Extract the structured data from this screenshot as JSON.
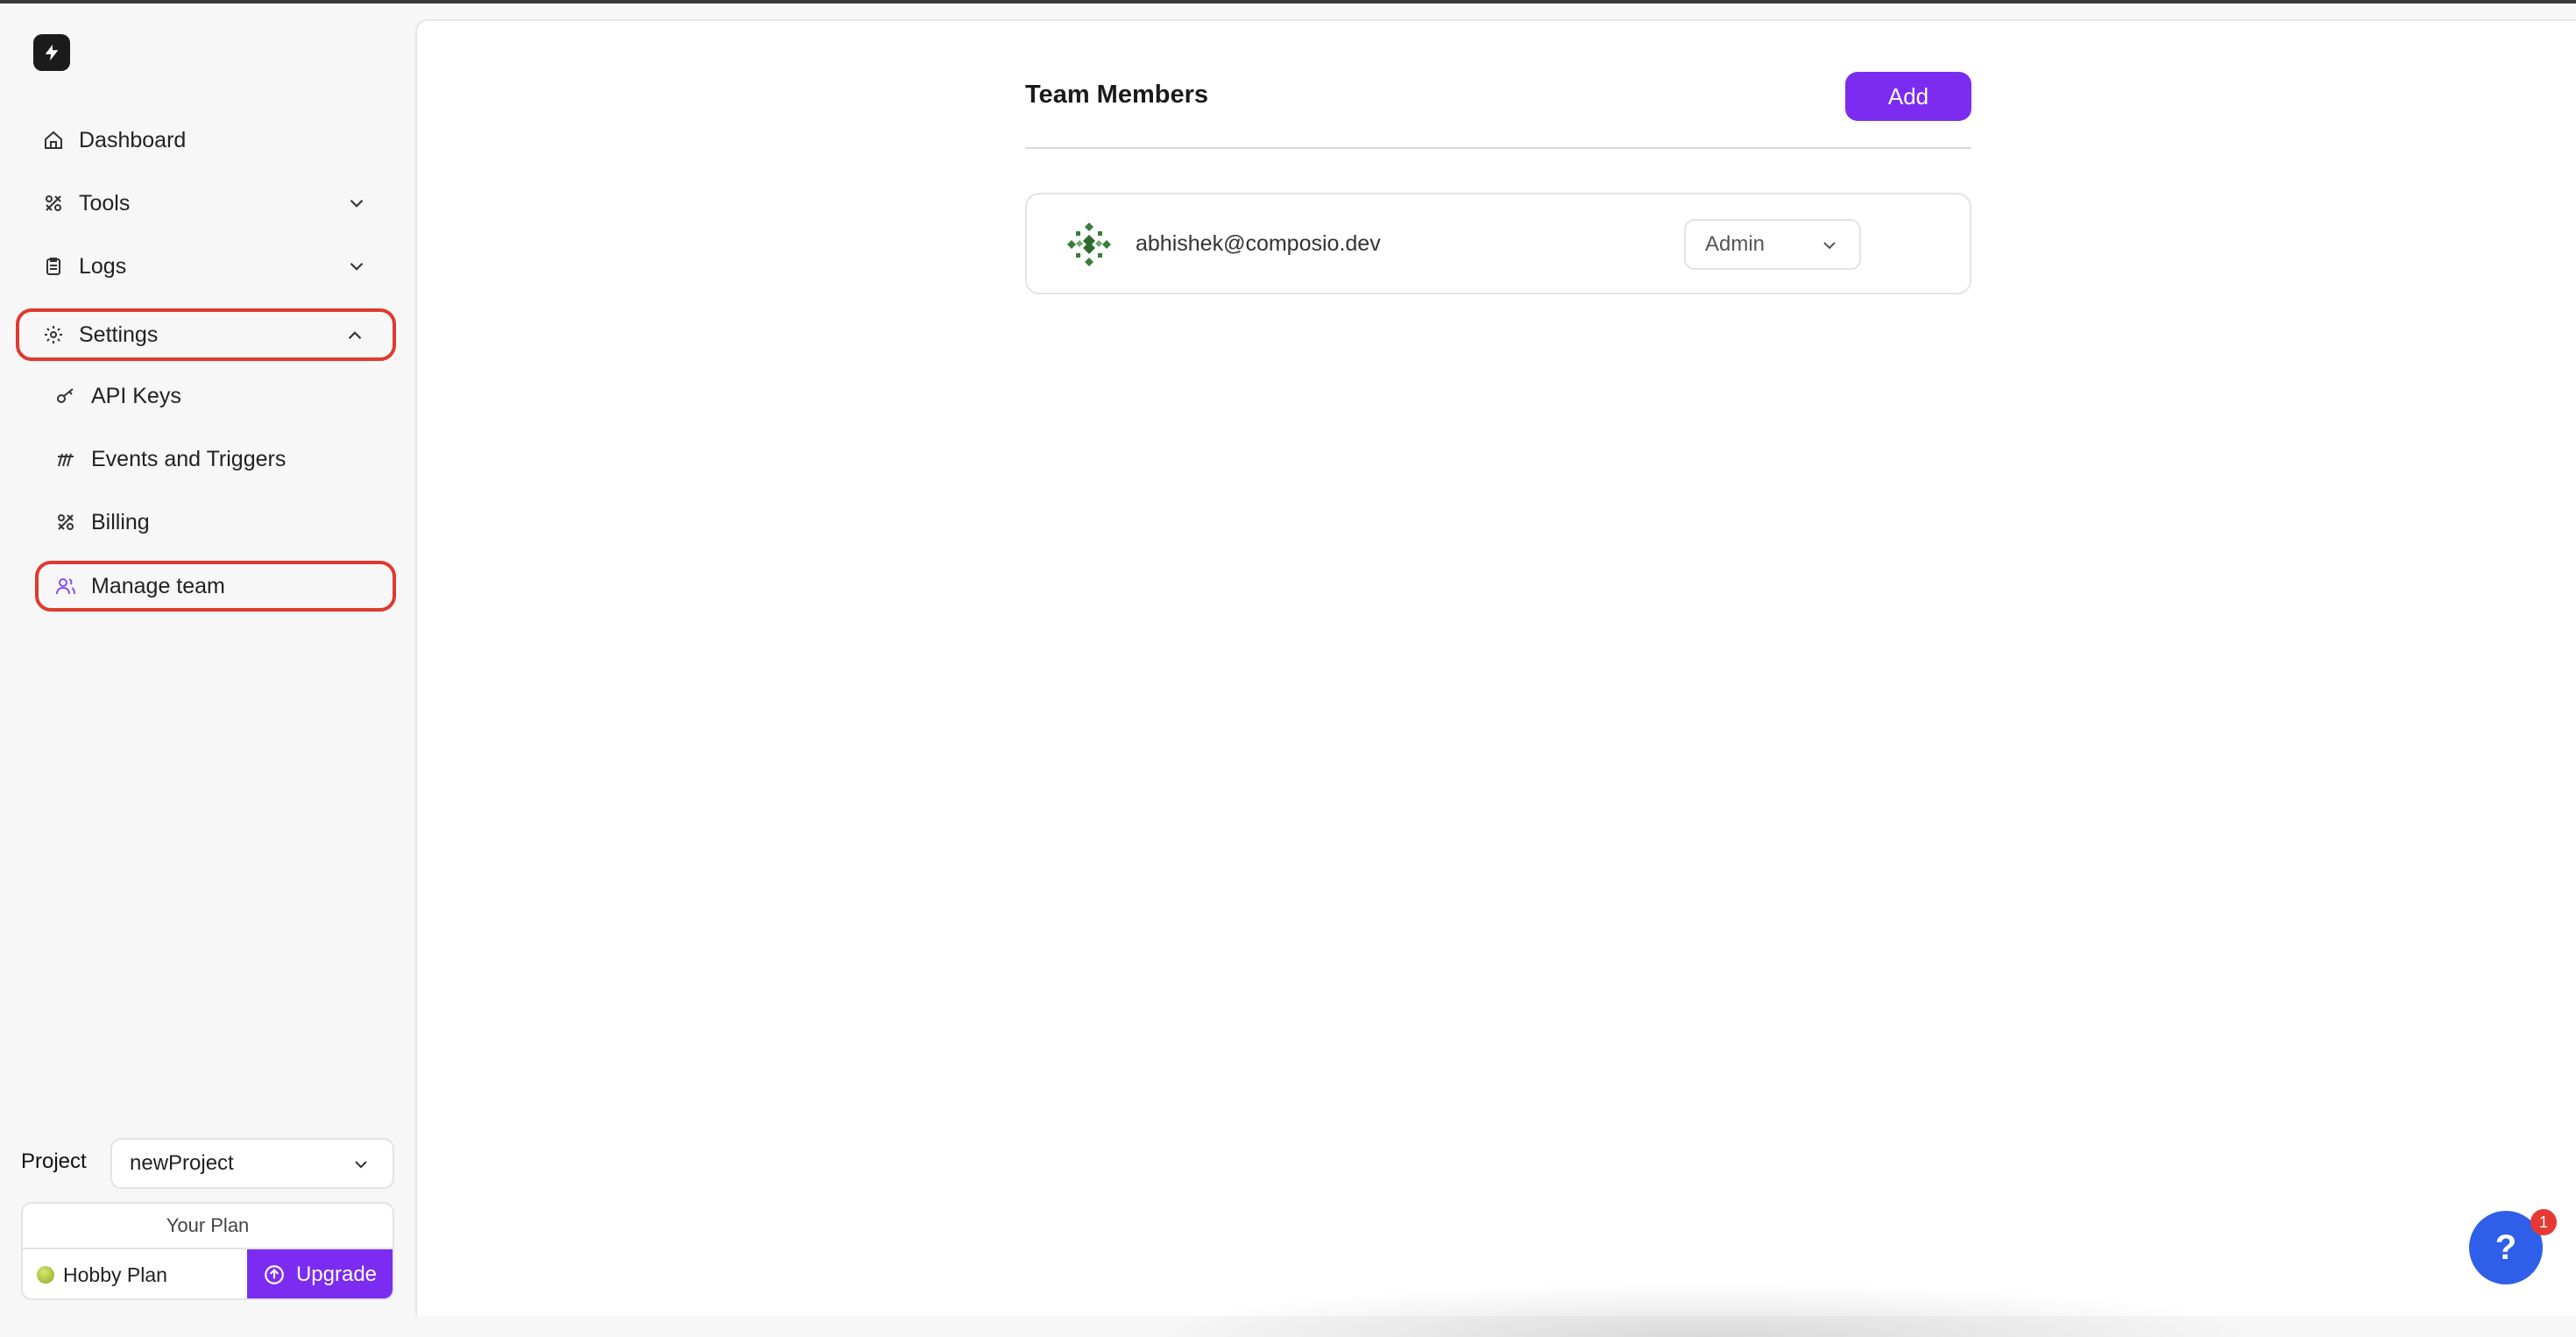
{
  "sidebar": {
    "items": [
      {
        "label": "Dashboard",
        "icon": "home-icon"
      },
      {
        "label": "Tools",
        "icon": "tools-icon"
      },
      {
        "label": "Logs",
        "icon": "clipboard-icon"
      },
      {
        "label": "Settings",
        "icon": "gear-icon"
      }
    ],
    "settings_sub": [
      {
        "label": "API Keys",
        "icon": "key-icon"
      },
      {
        "label": "Events and Triggers",
        "icon": "triggers-icon"
      },
      {
        "label": "Billing",
        "icon": "billing-icon"
      },
      {
        "label": "Manage team",
        "icon": "users-icon"
      }
    ]
  },
  "project": {
    "label": "Project",
    "selected": "newProject"
  },
  "plan": {
    "title": "Your Plan",
    "name": "Hobby Plan",
    "upgrade_label": "Upgrade"
  },
  "main": {
    "title": "Team Members",
    "add_label": "Add",
    "members": [
      {
        "email": "abhishek@composio.dev",
        "role": "Admin"
      }
    ]
  },
  "help": {
    "label": "?",
    "badge": "1"
  },
  "colors": {
    "accent": "#7c2cf0",
    "highlight": "#e03a2f",
    "help": "#2f5fe8"
  }
}
